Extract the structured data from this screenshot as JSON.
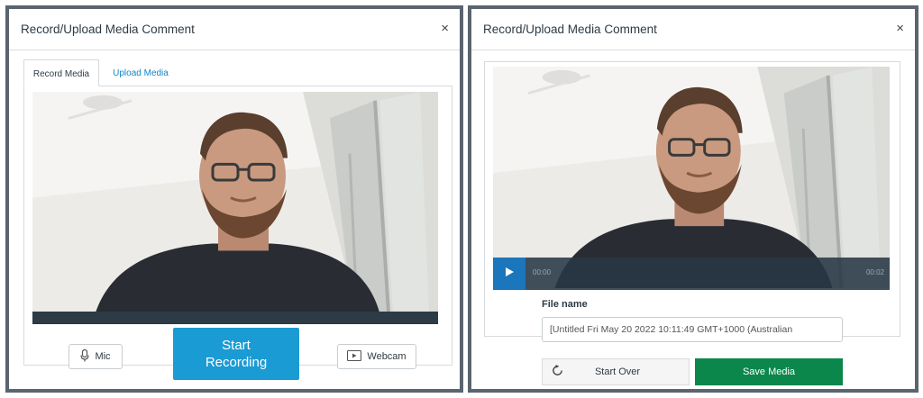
{
  "left_dialog": {
    "title": "Record/Upload Media Comment",
    "close_label": "×",
    "tabs": [
      {
        "label": "Record Media",
        "active": true
      },
      {
        "label": "Upload Media",
        "active": false
      }
    ],
    "mic_label": "Mic",
    "webcam_label": "Webcam",
    "start_recording_line1": "Start",
    "start_recording_line2": "Recording",
    "icons": [
      "microphone-icon",
      "webcam-icon"
    ]
  },
  "right_dialog": {
    "title": "Record/Upload Media Comment",
    "close_label": "×",
    "player": {
      "current_time": "00:00",
      "total_time": "00:02",
      "progress": 0.0
    },
    "file_name_label": "File name",
    "file_name_value": "[Untitled Fri May 20 2022 10:11:49 GMT+1000 (Australian",
    "start_over_label": "Start Over",
    "save_media_label": "Save Media",
    "icons": [
      "play-icon",
      "refresh-icon"
    ]
  },
  "colors": {
    "accent_blue": "#1b9bd3",
    "link_blue": "#0e86c9",
    "save_green": "#0b874b",
    "frame_gray": "#5b646f",
    "player_dark": "#2c3b45"
  }
}
